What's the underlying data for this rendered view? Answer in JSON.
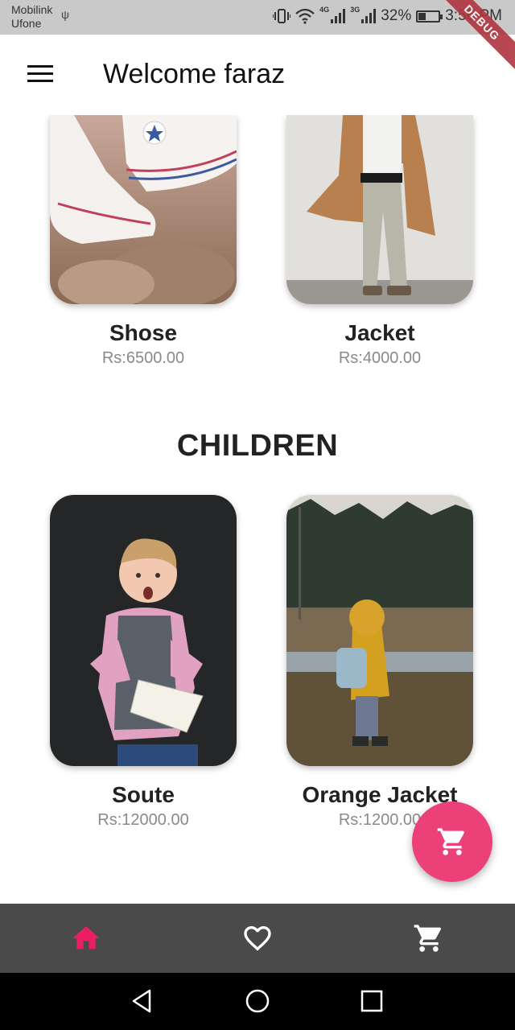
{
  "status_bar": {
    "carrier_1": "Mobilink",
    "carrier_2": "Ufone",
    "net_1": "4G",
    "net_2": "3G",
    "battery": "32%",
    "time": "3:56 PM"
  },
  "debug_label": "DEBUG",
  "app_bar": {
    "title": "Welcome faraz"
  },
  "sections": {
    "top": {
      "items": [
        {
          "name": "Shose",
          "price": "Rs:6500.00"
        },
        {
          "name": "Jacket",
          "price": "Rs:4000.00"
        }
      ]
    },
    "children": {
      "title": "CHILDREN",
      "items": [
        {
          "name": "Soute",
          "price": "Rs:12000.00"
        },
        {
          "name": "Orange Jacket",
          "price": "Rs:1200.00"
        }
      ]
    }
  },
  "bottom_nav": [
    "home-icon",
    "heart-icon",
    "cart-icon"
  ],
  "colors": {
    "accent": "#ec4079",
    "nav_bg": "#4a4a4a",
    "active_icon": "#e91e63"
  }
}
